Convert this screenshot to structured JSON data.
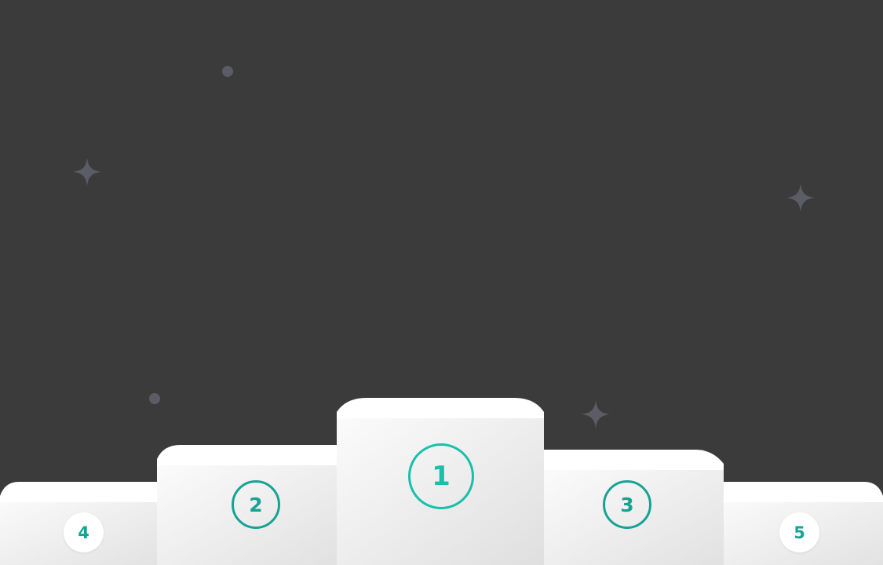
{
  "podium": {
    "first": {
      "rank": "1"
    },
    "second": {
      "rank": "2"
    },
    "third": {
      "rank": "3"
    },
    "fourth": {
      "rank": "4"
    },
    "fifth": {
      "rank": "5"
    }
  },
  "colors": {
    "background": "#3b3b3b",
    "accent": "#16a394",
    "accent_bright": "#18c0aa",
    "podium_top": "#ffffff",
    "podium_face": "#ececec",
    "decoration": "#5c5c66"
  },
  "decorations": [
    "dot-icon",
    "sparkle-icon"
  ]
}
